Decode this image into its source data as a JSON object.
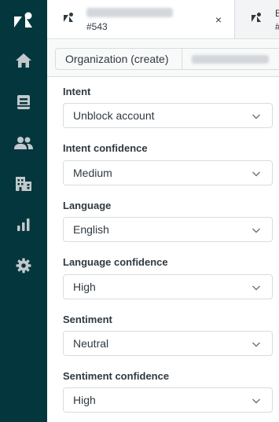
{
  "tabs": {
    "active": {
      "id": "#543",
      "close_glyph": "×"
    },
    "next": {
      "title": "E",
      "id": "#"
    }
  },
  "breadcrumb": {
    "organization_label": "Organization (create)"
  },
  "fields": [
    {
      "label": "Intent",
      "value": "Unblock account"
    },
    {
      "label": "Intent confidence",
      "value": "Medium"
    },
    {
      "label": "Language",
      "value": "English"
    },
    {
      "label": "Language confidence",
      "value": "High"
    },
    {
      "label": "Sentiment",
      "value": "Neutral"
    },
    {
      "label": "Sentiment confidence",
      "value": "High"
    }
  ],
  "nav": {
    "items": [
      "zendesk-logo-icon",
      "home-icon",
      "views-icon",
      "customers-icon",
      "organizations-icon",
      "reporting-icon",
      "admin-gear-icon"
    ],
    "colors": {
      "rail": "#03363d",
      "icon": "#ffffff"
    }
  }
}
